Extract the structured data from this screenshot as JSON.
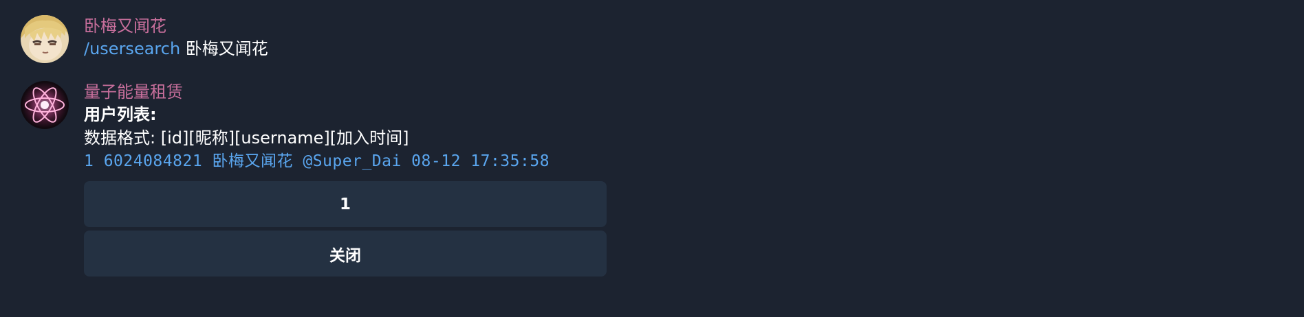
{
  "messages": [
    {
      "sender": "卧梅又闻花",
      "avatar_icon": "anime-girl-avatar",
      "command": "/usersearch",
      "text": "卧梅又闻花"
    },
    {
      "sender": "量子能量租赁",
      "avatar_icon": "atom-avatar",
      "title": "用户列表:",
      "format_line": "数据格式: [id][昵称][username][加入时间]",
      "result_line": "1 6024084821 卧梅又闻花 @Super_Dai 08-12 17:35:58",
      "buttons": [
        {
          "label": "1"
        },
        {
          "label": "关闭"
        }
      ]
    }
  ],
  "colors": {
    "background": "#1c2330",
    "sender_name": "#c86f9c",
    "link": "#5aa6ef",
    "button_bg": "#243142"
  }
}
